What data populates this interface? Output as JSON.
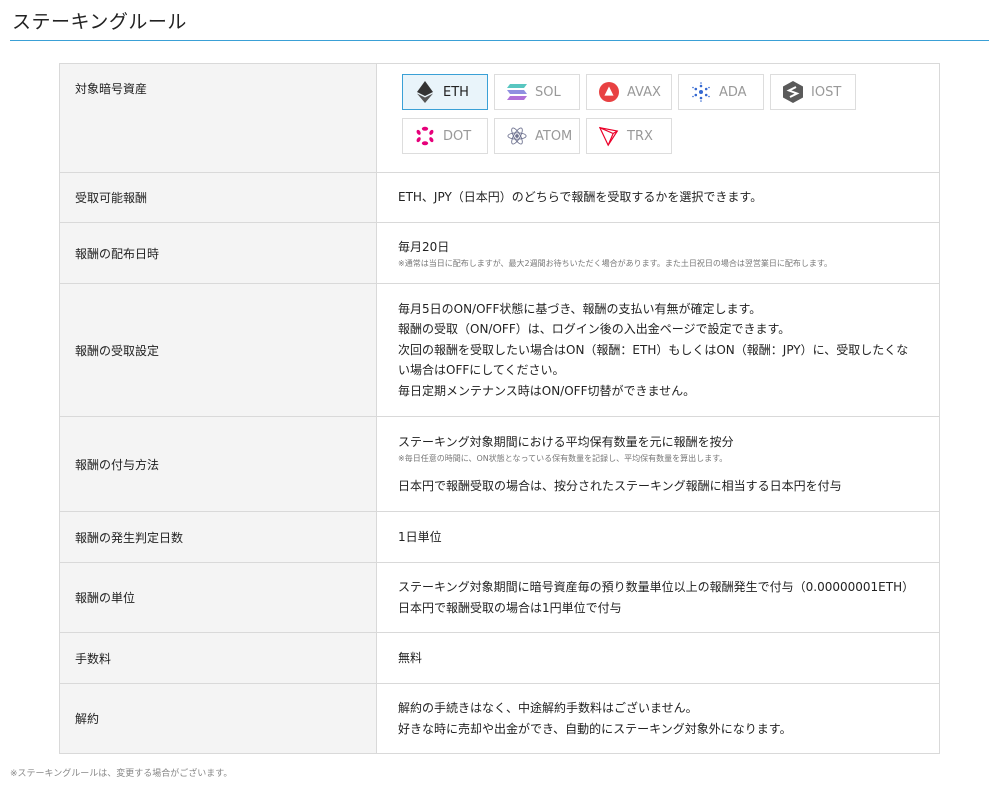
{
  "page": {
    "title": "ステーキングルール"
  },
  "coins": [
    {
      "label": "ETH",
      "icon": "eth-icon",
      "selected": true
    },
    {
      "label": "SOL",
      "icon": "sol-icon",
      "selected": false
    },
    {
      "label": "AVAX",
      "icon": "avax-icon",
      "selected": false
    },
    {
      "label": "ADA",
      "icon": "ada-icon",
      "selected": false
    },
    {
      "label": "IOST",
      "icon": "iost-icon",
      "selected": false
    },
    {
      "label": "DOT",
      "icon": "dot-icon",
      "selected": false
    },
    {
      "label": "ATOM",
      "icon": "atom-icon",
      "selected": false
    },
    {
      "label": "TRX",
      "icon": "trx-icon",
      "selected": false
    }
  ],
  "rows": {
    "assets": {
      "label": "対象暗号資産"
    },
    "rewards_receivable": {
      "label": "受取可能報酬",
      "text": "ETH、JPY（日本円）のどちらで報酬を受取するかを選択できます。"
    },
    "distribution_date": {
      "label": "報酬の配布日時",
      "text": "毎月20日",
      "note": "※通常は当日に配布しますが、最大2週間お待ちいただく場合があります。また土日祝日の場合は翌営業日に配布します。"
    },
    "receipt_setting": {
      "label": "報酬の受取設定",
      "lines": [
        "毎月5日のON/OFF状態に基づき、報酬の支払い有無が確定します。",
        "報酬の受取（ON/OFF）は、ログイン後の入出金ページで設定できます。",
        "次回の報酬を受取したい場合はON（報酬：ETH）もしくはON（報酬：JPY）に、受取したくな",
        "い場合はOFFにしてください。",
        "毎日定期メンテナンス時はON/OFF切替ができません。"
      ]
    },
    "grant_method": {
      "label": "報酬の付与方法",
      "text": "ステーキング対象期間における平均保有数量を元に報酬を按分",
      "note": "※毎日任意の時間に、ON状態となっている保有数量を記録し、平均保有数量を算出します。",
      "text2": "日本円で報酬受取の場合は、按分されたステーキング報酬に相当する日本円を付与"
    },
    "judgement_days": {
      "label": "報酬の発生判定日数",
      "text": "1日単位"
    },
    "unit": {
      "label": "報酬の単位",
      "lines": [
        "ステーキング対象期間に暗号資産毎の預り数量単位以上の報酬発生で付与（0.00000001ETH）",
        "日本円で報酬受取の場合は1円単位で付与"
      ]
    },
    "fee": {
      "label": "手数料",
      "text": "無料"
    },
    "cancellation": {
      "label": "解約",
      "lines": [
        "解約の手続きはなく、中途解約手数料はございません。",
        "好きな時に売却や出金ができ、自動的にステーキング対象外になります。"
      ]
    }
  },
  "footnote": "※ステーキングルールは、変更する場合がございます。",
  "colors": {
    "accent": "#3aa0d6",
    "label_bg": "#f4f4f4",
    "border": "#d9d9d9",
    "avax": "#e84142",
    "dot": "#e6007a",
    "trx": "#eb0029"
  }
}
